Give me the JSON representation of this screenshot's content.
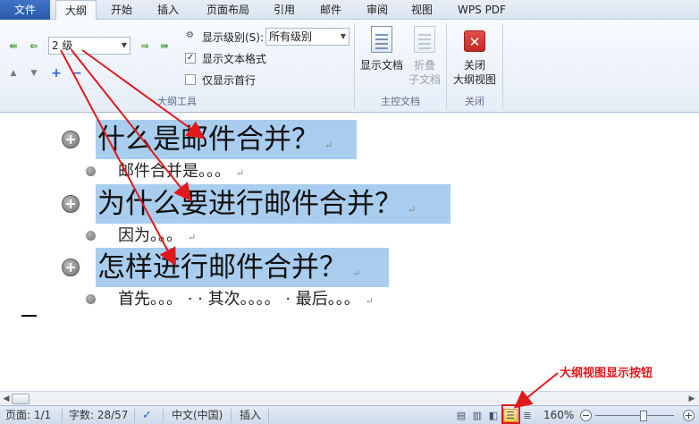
{
  "tabs": [
    {
      "label": "文件"
    },
    {
      "label": "大纲"
    },
    {
      "label": "开始"
    },
    {
      "label": "插入"
    },
    {
      "label": "页面布局"
    },
    {
      "label": "引用"
    },
    {
      "label": "邮件"
    },
    {
      "label": "审阅"
    },
    {
      "label": "视图"
    },
    {
      "label": "WPS PDF"
    }
  ],
  "outline_tools": {
    "level_value": "2 级",
    "show_level_label": "显示级别(S):",
    "show_level_value": "所有级别",
    "show_text_format_label": "显示文本格式",
    "show_text_format_checked": true,
    "show_first_line_label": "仅显示首行",
    "show_first_line_checked": false,
    "group_label": "大纲工具"
  },
  "master_doc": {
    "show_document_label": "显示文档",
    "collapse_subdoc_line1": "折叠",
    "collapse_subdoc_line2": "子文档",
    "group_label": "主控文档"
  },
  "close_group": {
    "close_line1": "关闭",
    "close_line2": "大纲视图",
    "group_label": "关闭"
  },
  "document": {
    "headings": [
      {
        "text": "什么是邮件合并？",
        "body": "邮件合并是。。。"
      },
      {
        "text": "为什么要进行邮件合并？",
        "body": "因为。。。"
      },
      {
        "text": "怎样进行邮件合并？",
        "body": "首先。。。 · · 其次。。。。 · 最后。。。"
      }
    ],
    "para_mark": "↵"
  },
  "status": {
    "page": "页面: 1/1",
    "words": "字数: 28/57",
    "language": "中文(中国)",
    "mode": "插入",
    "zoom": "160%"
  },
  "annotation": {
    "text": "大纲视图显示按钮",
    "color": "#e0191b"
  },
  "colors": {
    "heading_highlight": "#a9cdee",
    "file_tab": "#2a5aa8"
  }
}
